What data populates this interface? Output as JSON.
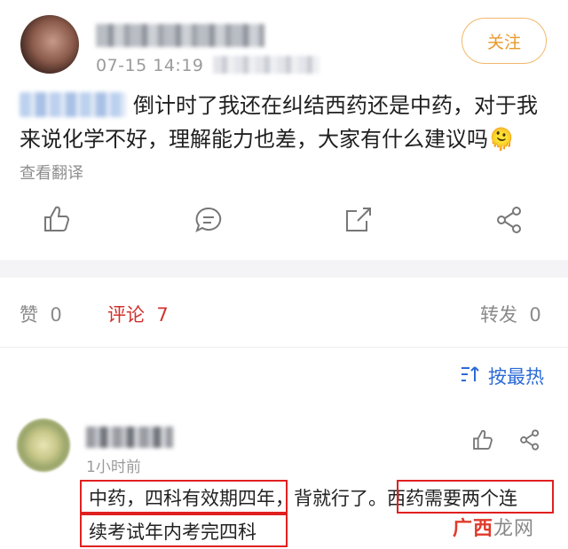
{
  "post": {
    "timestamp": "07-15 14:19",
    "follow_label": "关注",
    "text": "倒计时了我还在纠结西药还是中药，对于我来说化学不好，理解能力也差，大家有什么建议吗🫠",
    "translate_label": "查看翻译"
  },
  "stats": {
    "likes_label": "赞",
    "likes_count": "0",
    "comments_label": "评论",
    "comments_count": "7",
    "reposts_label": "转发",
    "reposts_count": "0"
  },
  "sort": {
    "label": "按最热"
  },
  "comment": {
    "time": "1小时前",
    "part1": "中药，四科有效期四年",
    "part2": "，背就行了。",
    "part3": "西药需要两个连",
    "part4": "续考试年内考完四科"
  },
  "watermark": {
    "text_red": "广西",
    "text_grey": "龙网"
  },
  "colors": {
    "accent_orange": "#e89a2c",
    "comment_red": "#d0312d",
    "sort_blue": "#2c6ad6"
  }
}
